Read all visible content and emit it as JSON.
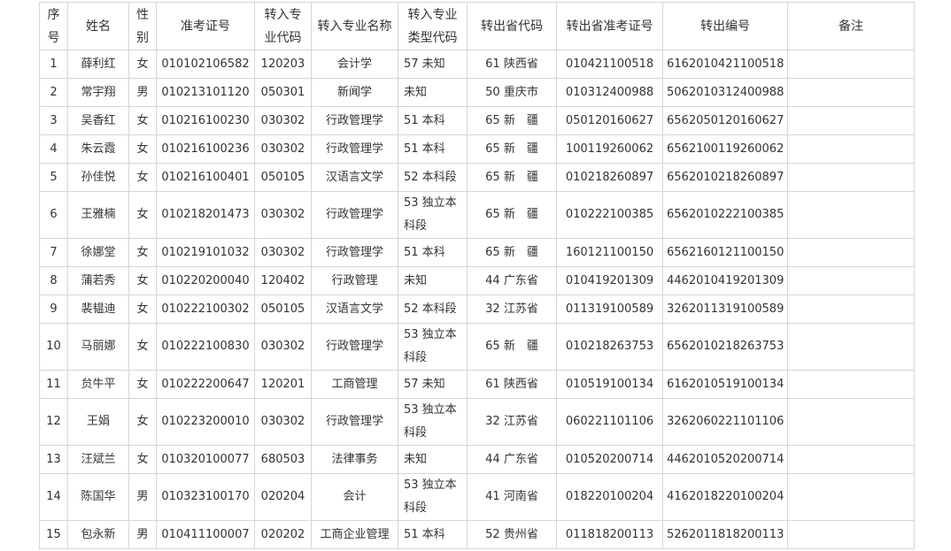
{
  "table": {
    "headers": [
      "序号",
      "姓名",
      "性别",
      "准考证号",
      "转入专业代码",
      "转入专业名称",
      "转入专业类型代码",
      "转出省代码",
      "转出省准考证号",
      "转出编号",
      "备注"
    ],
    "rows": [
      [
        "1",
        "薛利红",
        "女",
        "010102106582",
        "120203",
        "会计学",
        "57 未知",
        "61 陕西省",
        "010421100518",
        "6162010421100518",
        ""
      ],
      [
        "2",
        "常宇翔",
        "男",
        "010213101120",
        "050301",
        "新闻学",
        "未知",
        "50 重庆市",
        "010312400988",
        "5062010312400988",
        ""
      ],
      [
        "3",
        "吴香红",
        "女",
        "010216100230",
        "030302",
        "行政管理学",
        "51 本科",
        "65 新　疆",
        "050120160627",
        "6562050120160627",
        ""
      ],
      [
        "4",
        "朱云霞",
        "女",
        "010216100236",
        "030302",
        "行政管理学",
        "51 本科",
        "65 新　疆",
        "100119260062",
        "6562100119260062",
        ""
      ],
      [
        "5",
        "孙佳悦",
        "女",
        "010216100401",
        "050105",
        "汉语言文学",
        "52 本科段",
        "65 新　疆",
        "010218260897",
        "6562010218260897",
        ""
      ],
      [
        "6",
        "王雅楠",
        "女",
        "010218201473",
        "030302",
        "行政管理学",
        "53 独立本科段",
        "65 新　疆",
        "010222100385",
        "6562010222100385",
        ""
      ],
      [
        "7",
        "徐娜堂",
        "女",
        "010219101032",
        "030302",
        "行政管理学",
        "51 本科",
        "65 新　疆",
        "160121100150",
        "6562160121100150",
        ""
      ],
      [
        "8",
        "蒲若秀",
        "女",
        "010220200040",
        "120402",
        "行政管理",
        "未知",
        "44 广东省",
        "010419201309",
        "4462010419201309",
        ""
      ],
      [
        "9",
        "裴韫迪",
        "女",
        "010222100302",
        "050105",
        "汉语言文学",
        "52 本科段",
        "32 江苏省",
        "011319100589",
        "3262011319100589",
        ""
      ],
      [
        "10",
        "马丽娜",
        "女",
        "010222100830",
        "030302",
        "行政管理学",
        "53 独立本科段",
        "65 新　疆",
        "010218263753",
        "6562010218263753",
        ""
      ],
      [
        "11",
        "贠牛平",
        "女",
        "010222200647",
        "120201",
        "工商管理",
        "57 未知",
        "61 陕西省",
        "010519100134",
        "6162010519100134",
        ""
      ],
      [
        "12",
        "王娟",
        "女",
        "010223200010",
        "030302",
        "行政管理学",
        "53 独立本科段",
        "32 江苏省",
        "060221101106",
        "3262060221101106",
        ""
      ],
      [
        "13",
        "汪斌兰",
        "女",
        "010320100077",
        "680503",
        "法律事务",
        "未知",
        "44 广东省",
        "010520200714",
        "4462010520200714",
        ""
      ],
      [
        "14",
        "陈国华",
        "男",
        "010323100170",
        "020204",
        "会计",
        "53 独立本科段",
        "41 河南省",
        "018220100204",
        "4162018220100204",
        ""
      ],
      [
        "15",
        "包永新",
        "男",
        "010411100007",
        "020202",
        "工商企业管理",
        "51 本科",
        "52 贵州省",
        "011818200113",
        "5262011818200113",
        ""
      ]
    ]
  }
}
